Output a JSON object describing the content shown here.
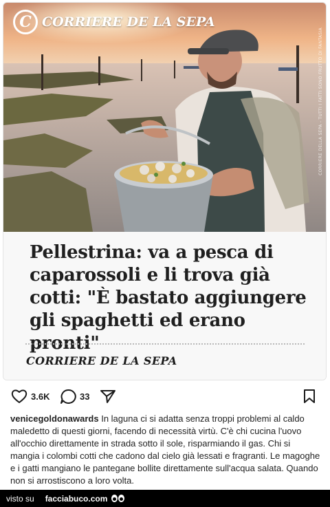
{
  "post": {
    "brand": "CORRIERE DE LA SEPA",
    "logo_letter": "C",
    "side_credit": "CORRIERE DELLA SEPA - TUTTI I FATTI SONO FRUTTO DI FANTASIA",
    "headline": "Pellestrina: va a pesca di caparossoli e li trova già cotti: \"È bastato aggiungere gli spaghetti ed erano pronti\"",
    "footer_brand": "CORRIERE DE LA SEPA"
  },
  "actions": {
    "likes": "3.6K",
    "comments": "33"
  },
  "caption": {
    "username": "venicegoldonawards",
    "text": "In laguna ci si adatta senza troppi problemi al caldo maledetto di questi giorni, facendo di necessità virtù. C'è chi cucina l'uovo all'occhio direttamente in strada sotto il sole, risparmiando il gas. Chi si mangia i colombi cotti che cadono dal cielo già lessati e fragranti. Le magoghe e i gatti mangiano le pantegane bollite direttamente sull'acqua salata. Quando non si arrostiscono a loro volta."
  },
  "footer": {
    "seen_on": "visto su",
    "site": "facciabuco.com"
  },
  "colors": {
    "sky": "#e9a77b",
    "water": "#b9a7a2",
    "panel": "#f8f8f8",
    "bar": "#000000"
  }
}
